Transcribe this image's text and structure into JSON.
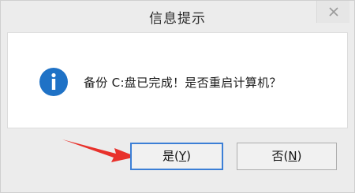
{
  "dialog": {
    "title": "信息提示",
    "message": "备份 C:盘已完成！是否重启计算机？",
    "icon": "info-icon",
    "close_icon": "close-icon"
  },
  "buttons": {
    "yes": {
      "text": "是(",
      "mnemonic": "Y",
      "suffix": ")"
    },
    "no": {
      "text": "否(",
      "mnemonic": "N",
      "suffix": ")"
    }
  },
  "annotation": {
    "arrow_icon": "red-arrow-icon",
    "color": "#e8312b"
  },
  "colors": {
    "info_icon": "#1f72c6",
    "focus_border": "#3c7fd6"
  }
}
